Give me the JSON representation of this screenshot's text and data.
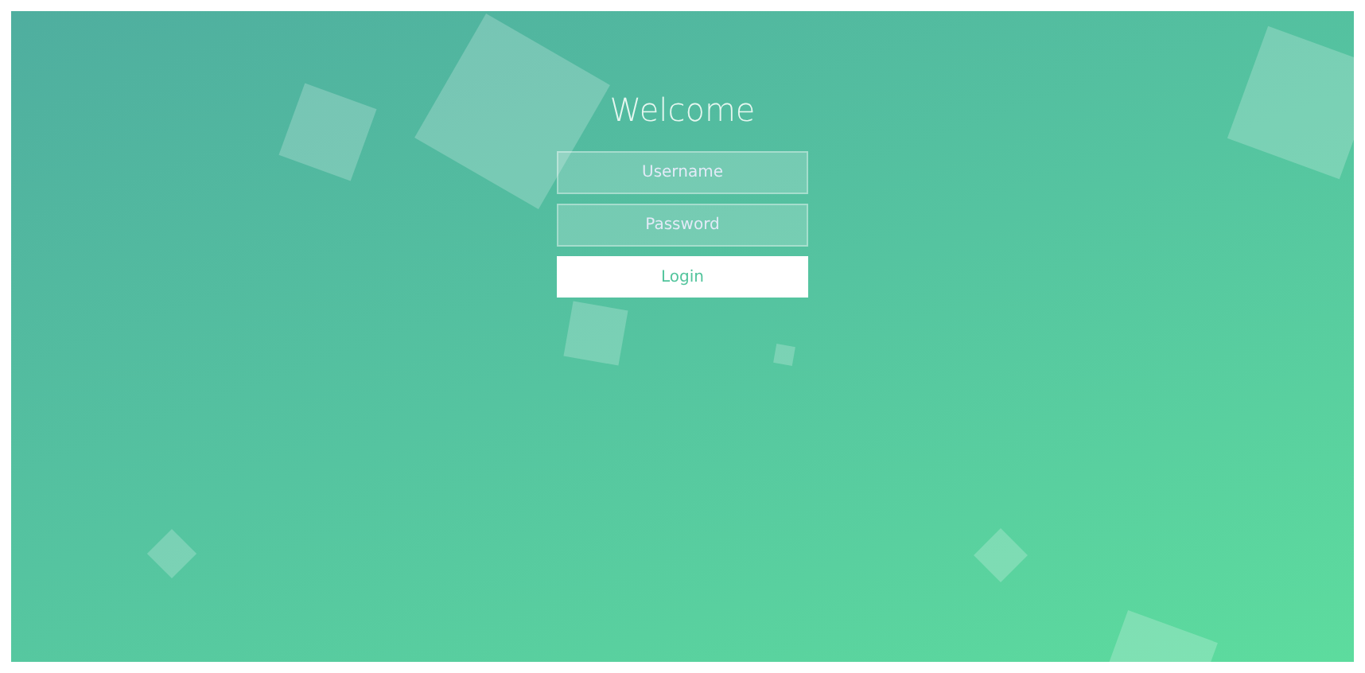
{
  "title": "Welcome",
  "username_field": {
    "placeholder": "Username"
  },
  "password_field": {
    "placeholder": "Password"
  },
  "login_button": "Login"
}
